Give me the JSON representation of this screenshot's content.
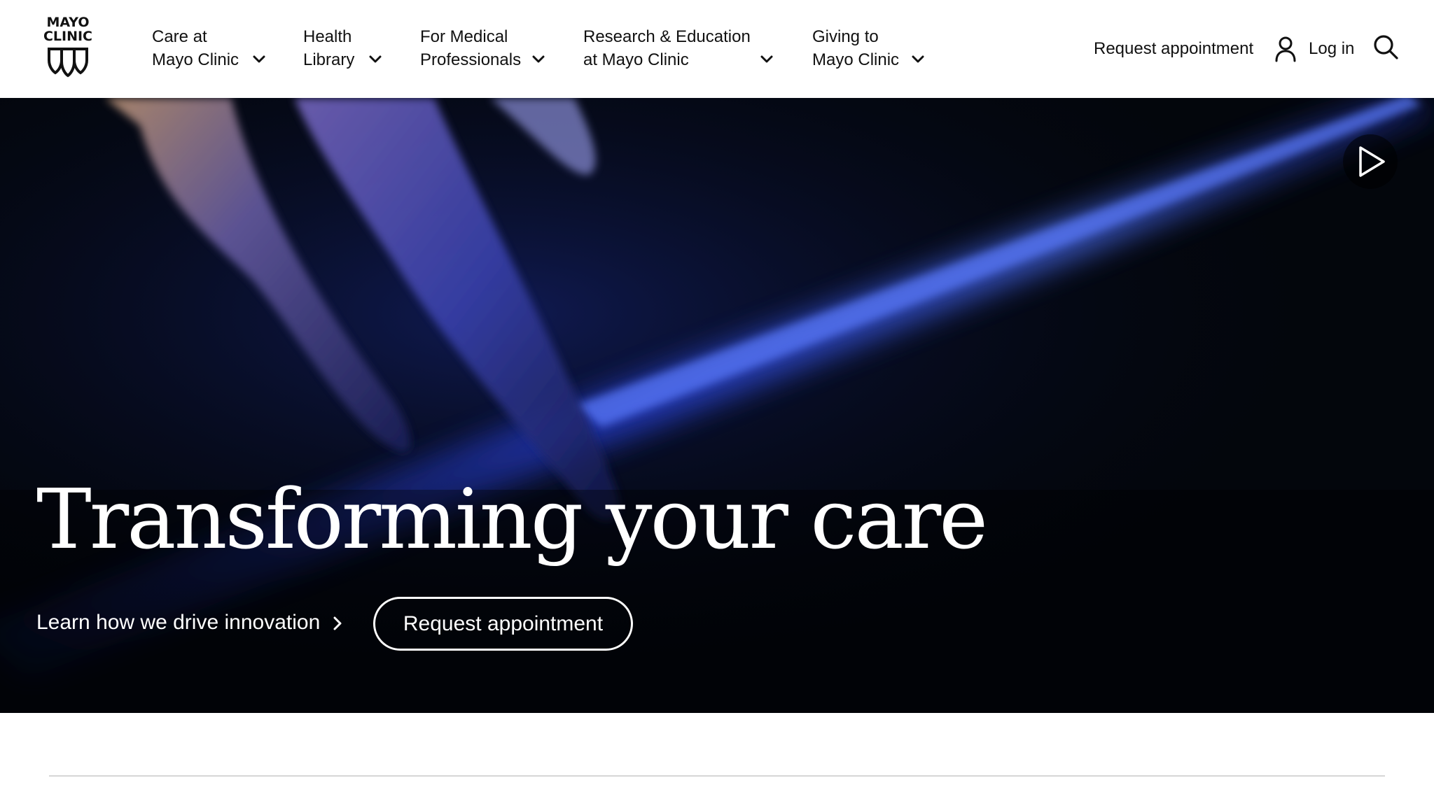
{
  "logo": {
    "text": "MAYO\nCLINIC",
    "icon": "three-shields-icon"
  },
  "nav": {
    "items": [
      {
        "line1": "Care at",
        "line2": "Mayo Clinic"
      },
      {
        "line1": "Health",
        "line2": "Library"
      },
      {
        "line1": "For Medical",
        "line2": "Professionals"
      },
      {
        "line1": "Research & Education",
        "line2": "at Mayo Clinic"
      },
      {
        "line1": "Giving to",
        "line2": "Mayo Clinic"
      }
    ]
  },
  "header_right": {
    "request_label": "Request appointment",
    "login_label": "Log in",
    "user_icon": "user-icon",
    "search_icon": "search-icon"
  },
  "hero": {
    "title": "Transforming your care",
    "link_label": "Learn how we drive innovation",
    "button_label": "Request appointment",
    "play_icon": "play-icon"
  },
  "colors": {
    "hero_background": "#03060c",
    "hero_highlight": "#2a3fd6",
    "text_dark": "#111111",
    "text_light": "#ffffff",
    "divider": "#d6d6d6"
  }
}
